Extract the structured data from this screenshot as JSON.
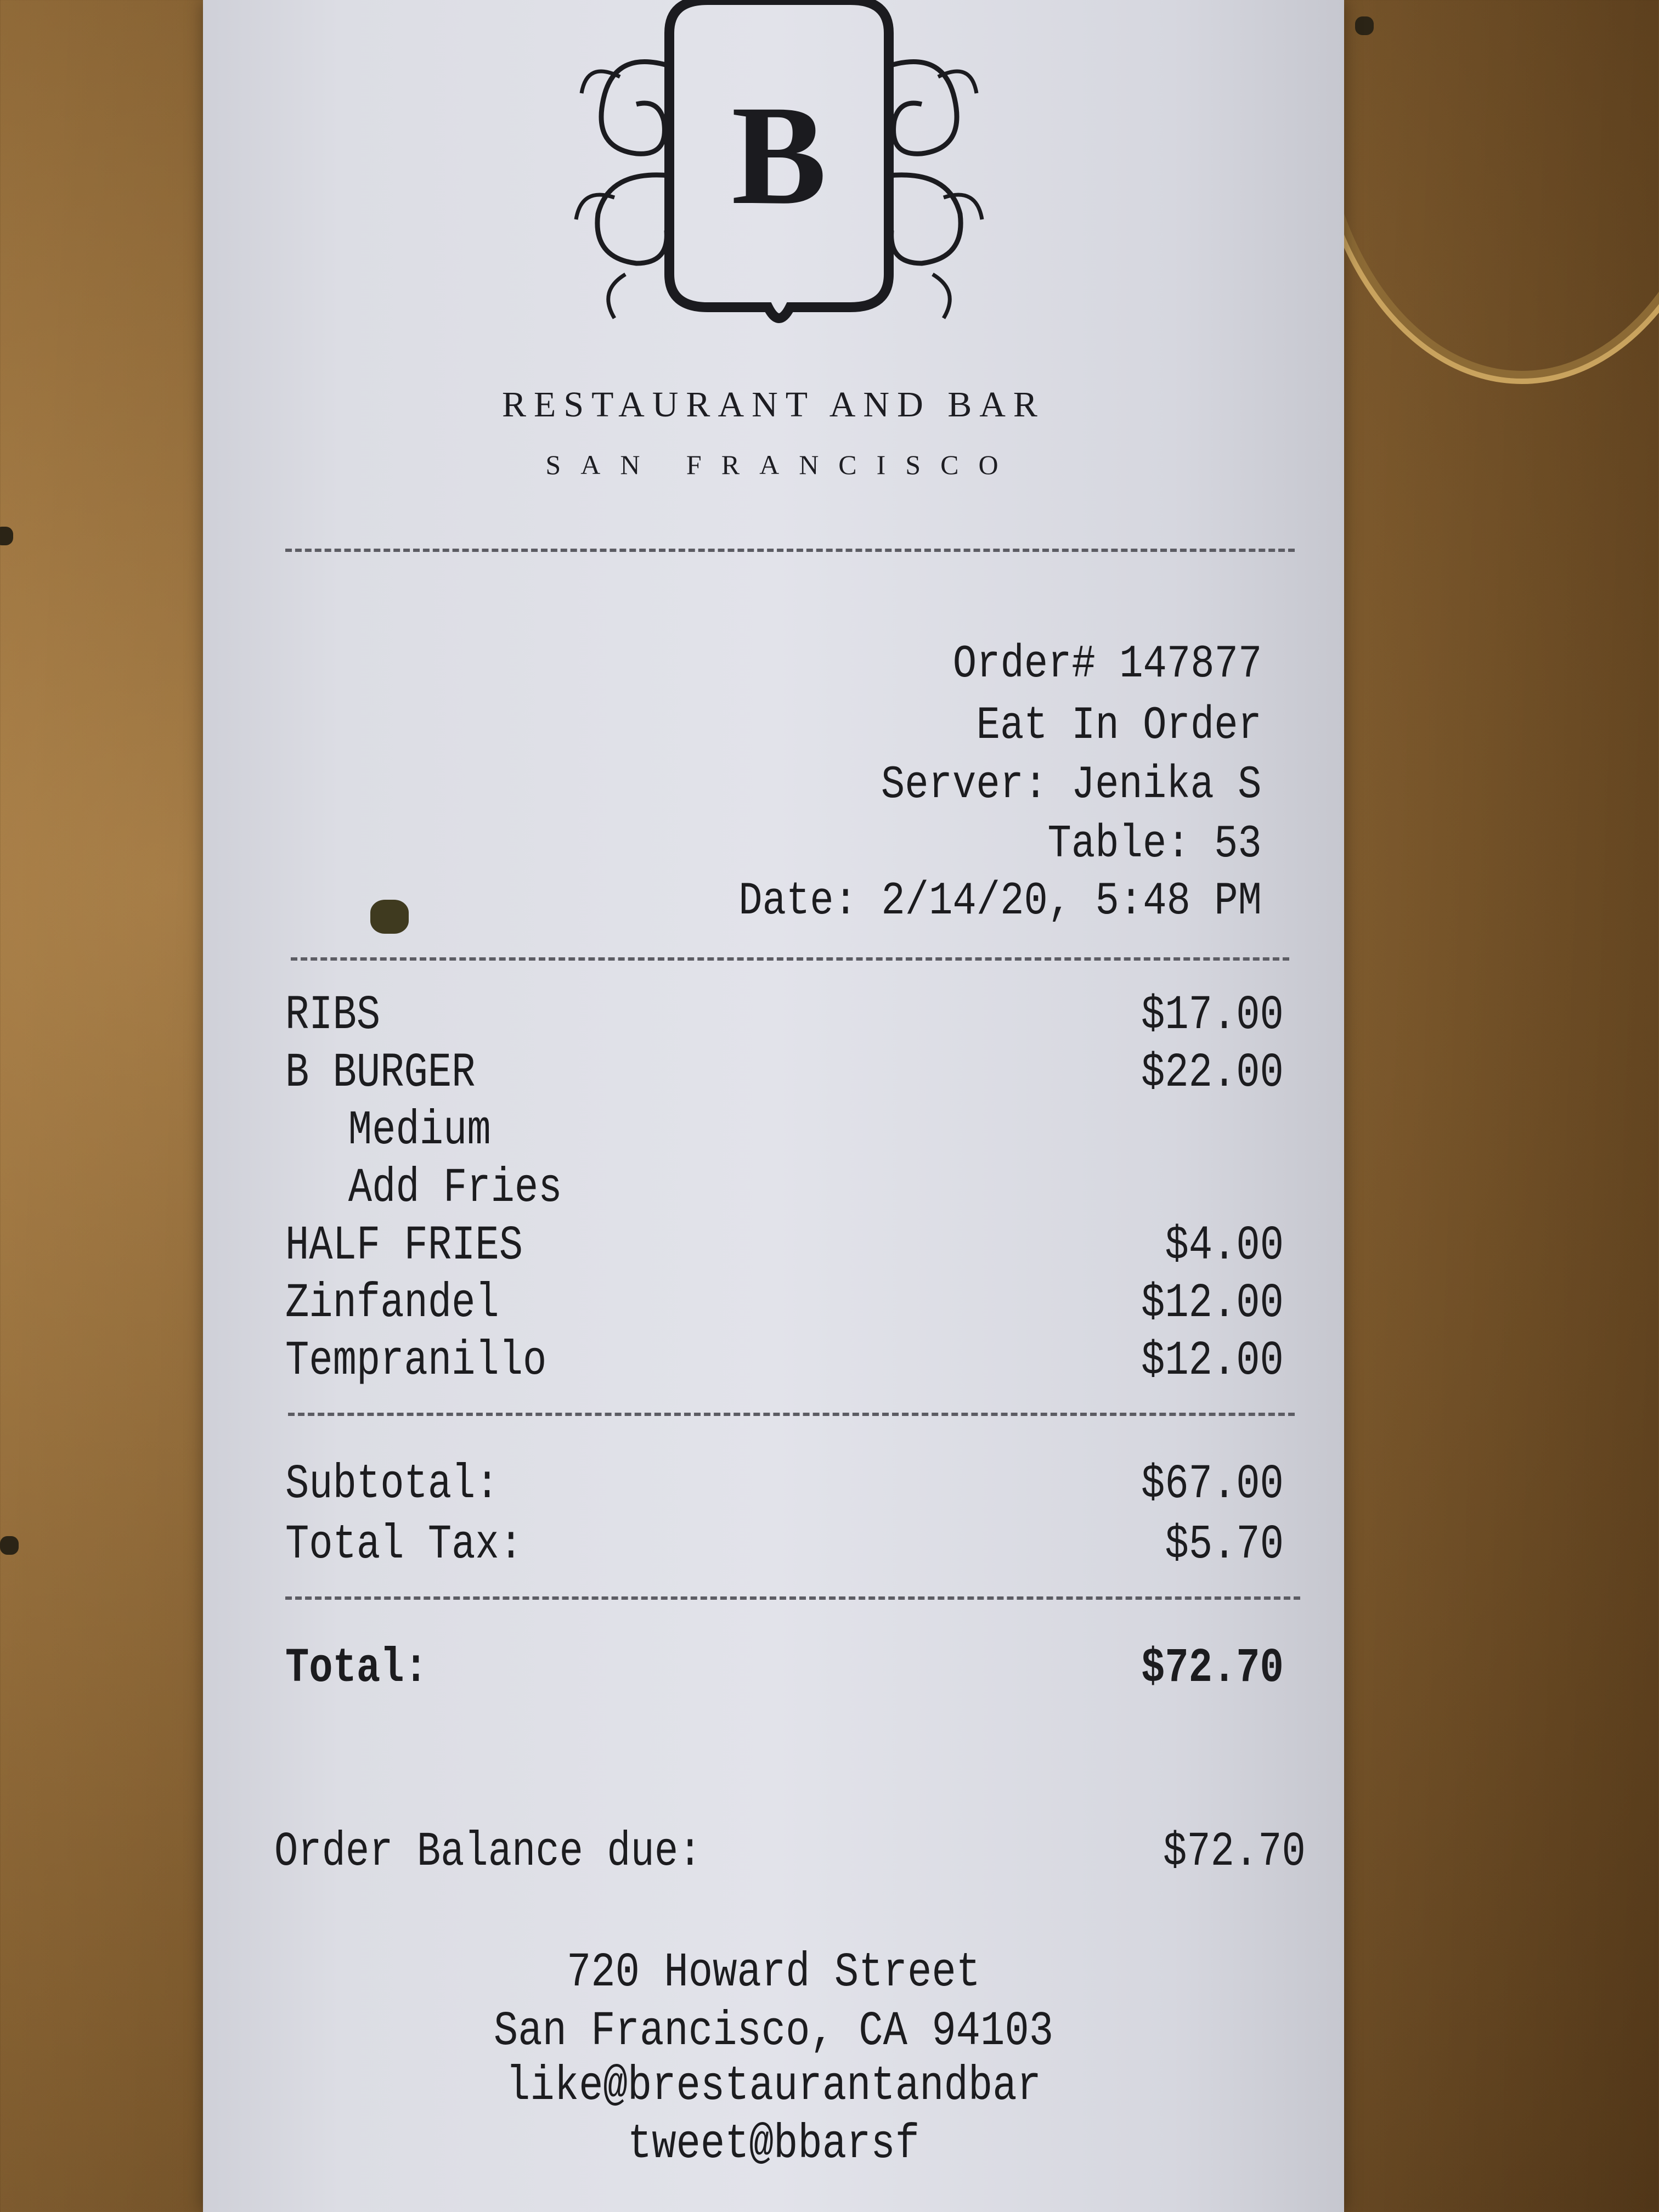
{
  "restaurant": {
    "logo_letter": "B",
    "name": "RESTAURANT AND BAR",
    "city": "SAN FRANCISCO"
  },
  "order": {
    "order_number": "Order# 147877",
    "order_type": "Eat In Order",
    "server": "Server: Jenika S",
    "table": "Table: 53",
    "date": "Date: 2/14/20, 5:48 PM"
  },
  "items": [
    {
      "name": "RIBS",
      "price": "$17.00"
    },
    {
      "name": "B BURGER",
      "price": "$22.00"
    },
    {
      "name": "Medium",
      "price": ""
    },
    {
      "name": "Add Fries",
      "price": ""
    },
    {
      "name": "HALF FRIES",
      "price": "$4.00"
    },
    {
      "name": "Zinfandel",
      "price": "$12.00"
    },
    {
      "name": "Tempranillo",
      "price": "$12.00"
    }
  ],
  "totals": {
    "subtotal_label": "Subtotal:",
    "subtotal": "$67.00",
    "tax_label": "Total Tax:",
    "tax": "$5.70",
    "total_label": "Total:",
    "total": "$72.70",
    "balance_label": "Order Balance due:",
    "balance": "$72.70"
  },
  "footer": {
    "street": "720 Howard Street",
    "city_line": "San Francisco, CA 94103",
    "facebook": "like@brestaurantandbar",
    "twitter": "tweet@bbarsf"
  }
}
